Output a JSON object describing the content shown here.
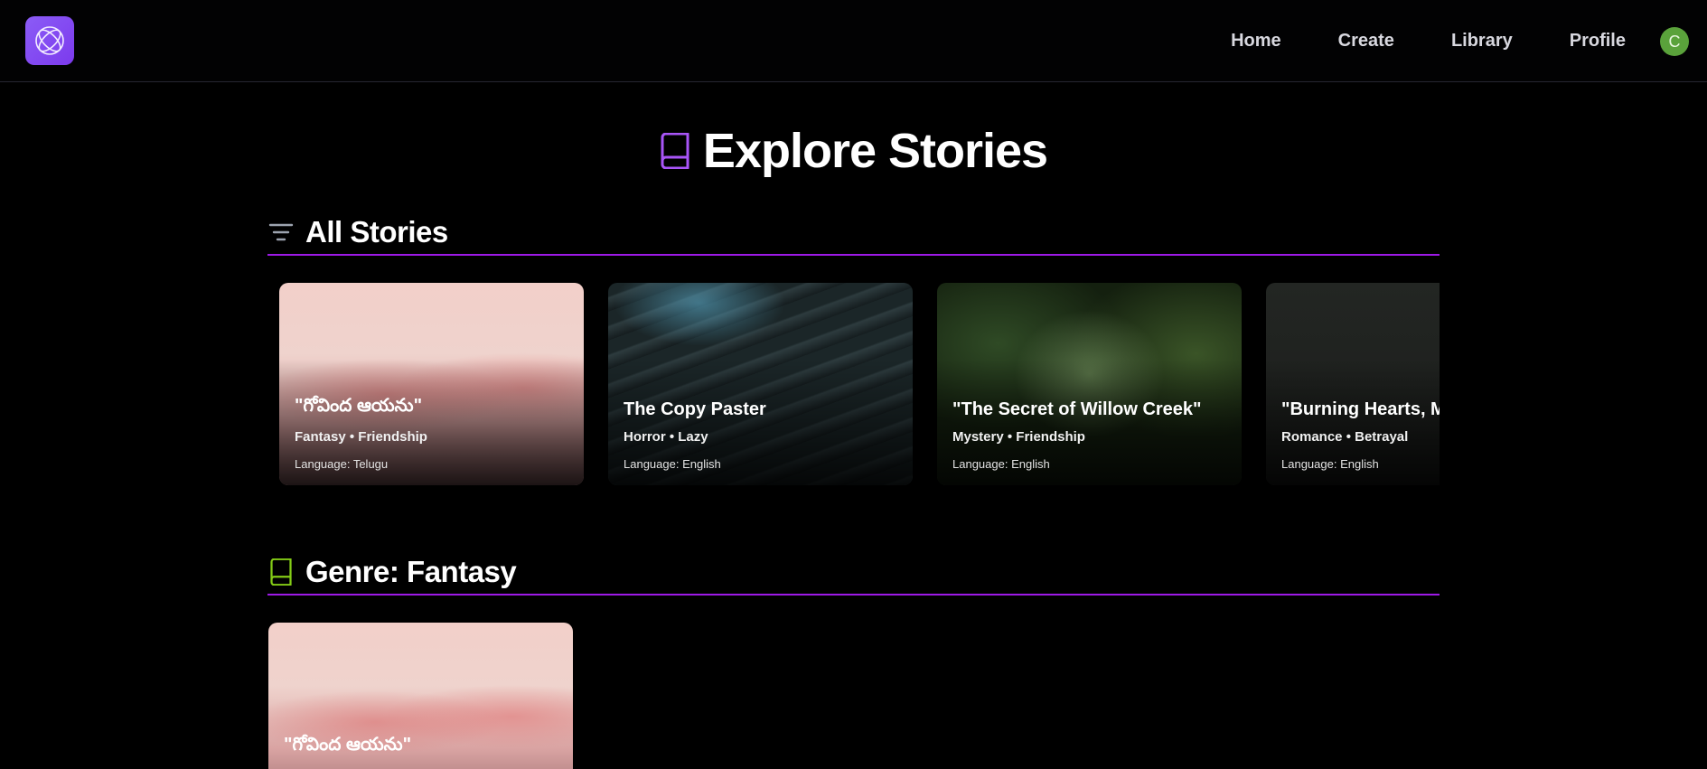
{
  "nav": {
    "links": [
      "Home",
      "Create",
      "Library",
      "Profile"
    ],
    "avatar_initial": "C"
  },
  "page": {
    "title": "Explore Stories"
  },
  "sections": [
    {
      "title": "All Stories",
      "cards": [
        {
          "title": "\"గోవింద ఆయను\"",
          "genres": "Fantasy • Friendship",
          "language": "Language: Telugu"
        },
        {
          "title": "The Copy Paster",
          "genres": "Horror • Lazy",
          "language": "Language: English"
        },
        {
          "title": "\"The Secret of Willow Creek\"",
          "genres": "Mystery • Friendship",
          "language": "Language: English"
        },
        {
          "title": "\"Burning Hearts, M",
          "genres": "Romance • Betrayal",
          "language": "Language: English"
        }
      ]
    },
    {
      "title": "Genre: Fantasy",
      "cards": [
        {
          "title": "\"గోవింద ఆయను\""
        }
      ]
    }
  ],
  "colors": {
    "accent_purple": "#9d19e6",
    "logo_purple": "#8b5cf6",
    "book_icon_purple": "#a855f7",
    "book_icon_green": "#84cc16",
    "avatar_green": "#5aa23b"
  },
  "icons": {
    "logo": "atom-circle-logo-icon",
    "title": "book-icon",
    "all_stories": "filter-lines-icon",
    "genre": "book-icon"
  }
}
